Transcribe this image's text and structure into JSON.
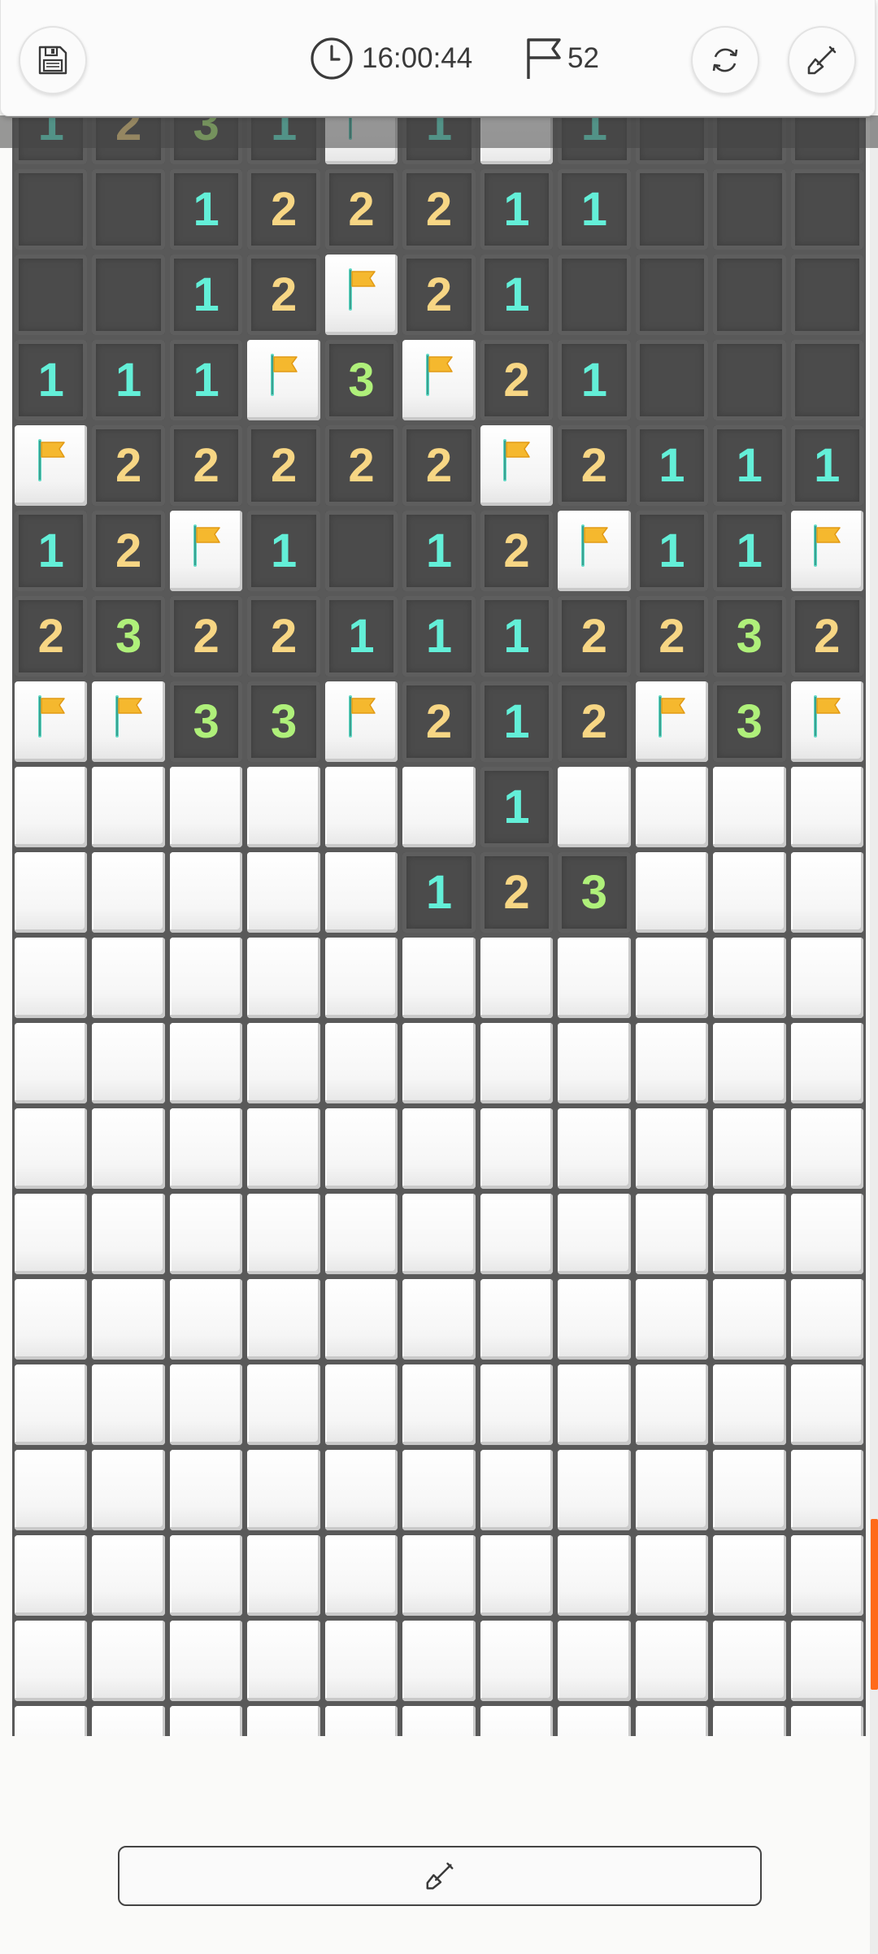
{
  "header": {
    "time": "16:00:44",
    "flags_remaining": "52",
    "icons": {
      "save": "floppy-disk-icon",
      "clock": "clock-icon",
      "flag": "flag-outline-icon",
      "refresh": "refresh-icon",
      "shovel": "shovel-icon"
    }
  },
  "colors": {
    "number_1": "#63efd8",
    "number_2": "#f7d684",
    "number_3": "#aff07a",
    "flag": "#f5b82e",
    "scroll_thumb": "#ff6a1a"
  },
  "board": {
    "columns": 11,
    "legend": "digits = revealed count, F = flag, . = revealed empty, # = covered",
    "rows": [
      "1231F1#1...",
      "..12221 1...",
      "..12F21....",
      "111F3F21...",
      "F22222F2111",
      "12F1.12F11F",
      "23221112232",
      "FF33F212F3F",
      "######1####",
      "#####123###",
      "###########",
      "###########",
      "###########",
      "###########",
      "###########",
      "###########",
      "###########",
      "###########",
      "###########",
      "###########",
      "###########"
    ]
  },
  "bottom_button": {
    "icon": "shovel-icon"
  }
}
